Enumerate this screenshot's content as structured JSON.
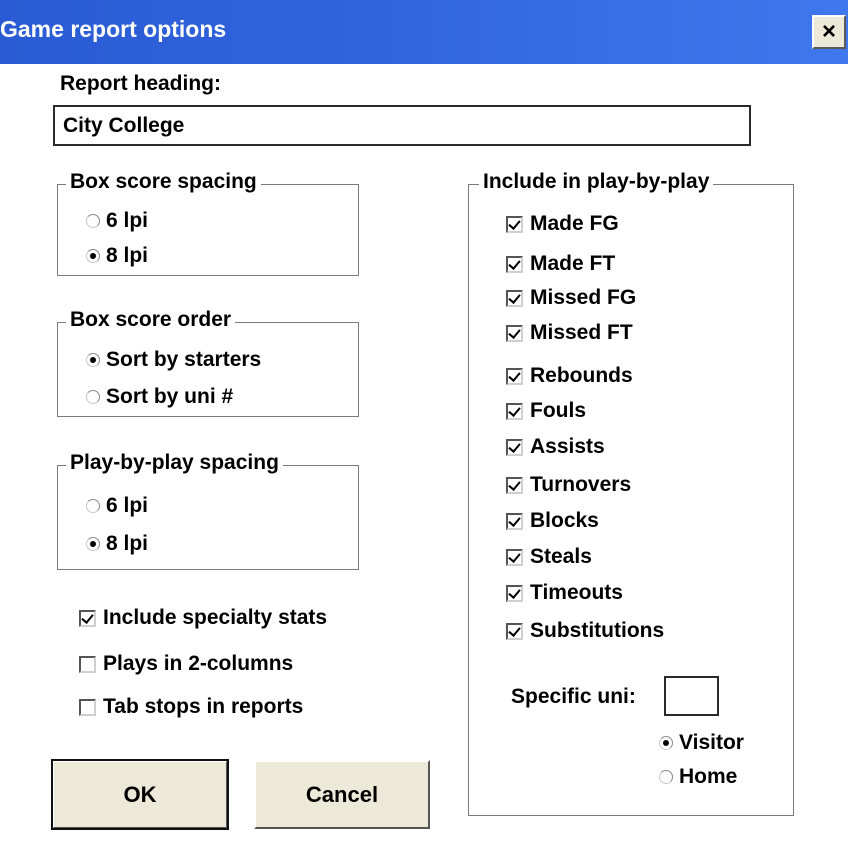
{
  "window": {
    "title": "Game report options",
    "close_label": "×"
  },
  "report_heading": {
    "label": "Report heading:",
    "value": "City College"
  },
  "box_score_spacing": {
    "legend": "Box score spacing",
    "options": [
      {
        "label": "6 lpi",
        "selected": false
      },
      {
        "label": "8 lpi",
        "selected": true
      }
    ]
  },
  "box_score_order": {
    "legend": "Box score order",
    "options": [
      {
        "label": "Sort by starters",
        "selected": true
      },
      {
        "label": "Sort by uni #",
        "selected": false
      }
    ]
  },
  "pbp_spacing": {
    "legend": "Play-by-play spacing",
    "options": [
      {
        "label": "6 lpi",
        "selected": false
      },
      {
        "label": "8 lpi",
        "selected": true
      }
    ]
  },
  "options": [
    {
      "label": "Include specialty stats",
      "checked": true
    },
    {
      "label": "Plays in 2-columns",
      "checked": false
    },
    {
      "label": "Tab stops in reports",
      "checked": false
    }
  ],
  "include_pbp": {
    "legend": "Include in play-by-play",
    "items": [
      {
        "label": "Made FG",
        "checked": true
      },
      {
        "label": "Made FT",
        "checked": true
      },
      {
        "label": "Missed FG",
        "checked": true
      },
      {
        "label": "Missed FT",
        "checked": true
      },
      {
        "label": "Rebounds",
        "checked": true
      },
      {
        "label": "Fouls",
        "checked": true
      },
      {
        "label": "Assists",
        "checked": true
      },
      {
        "label": "Turnovers",
        "checked": true
      },
      {
        "label": "Blocks",
        "checked": true
      },
      {
        "label": "Steals",
        "checked": true
      },
      {
        "label": "Timeouts",
        "checked": true
      },
      {
        "label": "Substitutions",
        "checked": true
      }
    ],
    "specific_uni_label": "Specific uni:",
    "specific_uni_value": "",
    "team_options": [
      {
        "label": "Visitor",
        "selected": true
      },
      {
        "label": "Home",
        "selected": false
      }
    ]
  },
  "buttons": {
    "ok": "OK",
    "cancel": "Cancel"
  }
}
